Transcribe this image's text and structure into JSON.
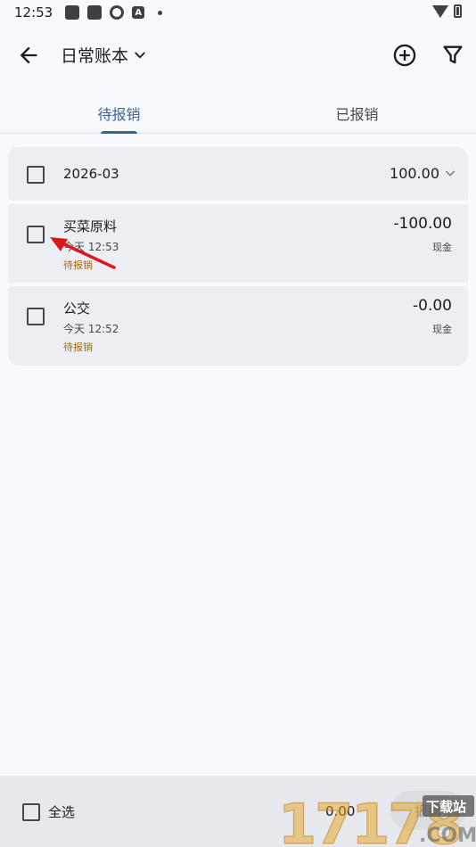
{
  "status_bar": {
    "time": "12:53",
    "letter_icon": "A"
  },
  "app_bar": {
    "title": "日常账本"
  },
  "tabs": [
    {
      "label": "待报销",
      "active": true
    },
    {
      "label": "已报销",
      "active": false
    }
  ],
  "group": {
    "label": "2026-03",
    "total": "100.00"
  },
  "items": [
    {
      "name": "买菜原料",
      "time": "今天 12:53",
      "status": "待报销",
      "amount": "-100.00",
      "account": "现金"
    },
    {
      "name": "公交",
      "time": "今天 12:52",
      "status": "待报销",
      "amount": "-0.00",
      "account": "现金"
    }
  ],
  "bottom_bar": {
    "select_all": "全选",
    "total": "0.00",
    "action": "报销"
  },
  "watermark": {
    "number": "17178",
    "site": "下载站",
    "domain": ".COM"
  },
  "colors": {
    "accent": "#3a6591",
    "pending": "#a16a08",
    "annotation": "#d7191c"
  }
}
